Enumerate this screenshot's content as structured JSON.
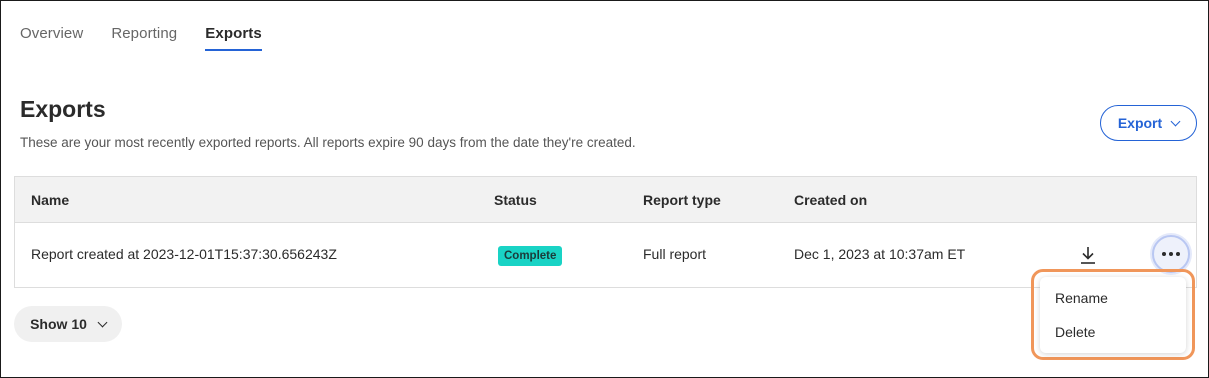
{
  "tabs": [
    {
      "label": "Overview",
      "active": false
    },
    {
      "label": "Reporting",
      "active": false
    },
    {
      "label": "Exports",
      "active": true
    }
  ],
  "page": {
    "title": "Exports",
    "subtitle": "These are your most recently exported reports. All reports expire 90 days from the date they're created.",
    "export_button": "Export"
  },
  "table": {
    "headers": {
      "name": "Name",
      "status": "Status",
      "report_type": "Report type",
      "created_on": "Created on"
    },
    "rows": [
      {
        "name": "Report created at 2023-12-01T15:37:30.656243Z",
        "status": "Complete",
        "report_type": "Full report",
        "created_on": "Dec 1, 2023 at 10:37am ET"
      }
    ]
  },
  "pagination": {
    "show_label": "Show 10"
  },
  "row_menu": {
    "items": [
      "Rename",
      "Delete"
    ]
  },
  "colors": {
    "accent": "#2463d6",
    "status_complete": "#19d3c5",
    "highlight": "#f0965a"
  },
  "icons": [
    "chevron-down-icon",
    "download-icon",
    "more-options-icon"
  ]
}
